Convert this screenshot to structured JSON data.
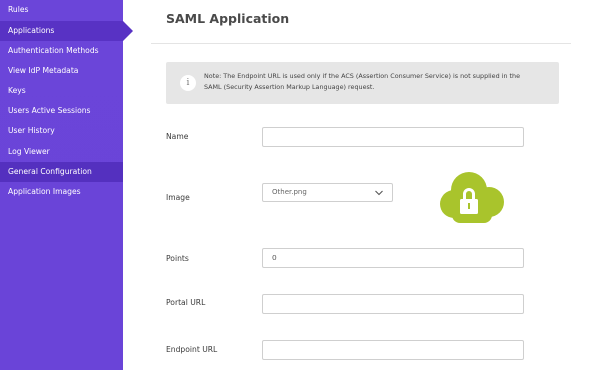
{
  "sidebar": {
    "items": [
      {
        "label": "Rules"
      },
      {
        "label": "Applications"
      },
      {
        "label": "Authentication Methods"
      },
      {
        "label": "View IdP Metadata"
      },
      {
        "label": "Keys"
      },
      {
        "label": "Users Active Sessions"
      },
      {
        "label": "User History"
      },
      {
        "label": "Log Viewer"
      },
      {
        "label": "General Configuration"
      },
      {
        "label": "Application Images"
      }
    ],
    "active": "Applications",
    "highlighted": "General Configuration"
  },
  "header": {
    "title": "SAML Application"
  },
  "note": {
    "line1": "Note: The Endpoint URL is used only if the ACS (Assertion Consumer Service) is not supplied in the",
    "line2": "SAML (Security Assertion Markup Language) request."
  },
  "form": {
    "name": {
      "label": "Name",
      "value": ""
    },
    "image": {
      "label": "Image",
      "selected": "Other.png",
      "preview_icon": "cloud-lock-icon"
    },
    "points": {
      "label": "Points",
      "value": "0"
    },
    "portal_url": {
      "label": "Portal URL",
      "value": ""
    },
    "endpoint_url": {
      "label": "Endpoint URL",
      "value": ""
    }
  },
  "colors": {
    "sidebar": "#6b45d9",
    "sidebar_active": "#5832c4",
    "cloud": "#a9c42c",
    "note_bg": "#e6e6e6"
  }
}
